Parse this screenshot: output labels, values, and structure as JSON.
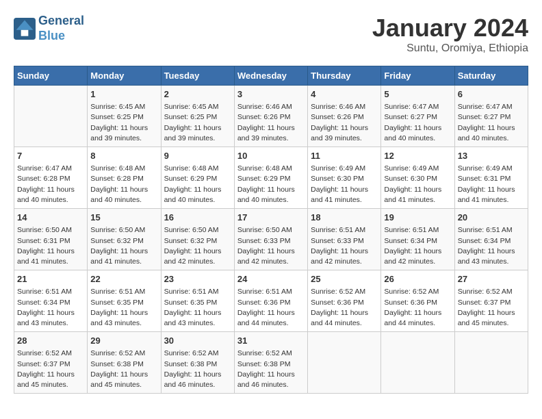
{
  "header": {
    "logo_line1": "General",
    "logo_line2": "Blue",
    "main_title": "January 2024",
    "subtitle": "Suntu, Oromiya, Ethiopia"
  },
  "weekdays": [
    "Sunday",
    "Monday",
    "Tuesday",
    "Wednesday",
    "Thursday",
    "Friday",
    "Saturday"
  ],
  "weeks": [
    [
      {
        "day": "",
        "content": ""
      },
      {
        "day": "1",
        "content": "Sunrise: 6:45 AM\nSunset: 6:25 PM\nDaylight: 11 hours and 39 minutes."
      },
      {
        "day": "2",
        "content": "Sunrise: 6:45 AM\nSunset: 6:25 PM\nDaylight: 11 hours and 39 minutes."
      },
      {
        "day": "3",
        "content": "Sunrise: 6:46 AM\nSunset: 6:26 PM\nDaylight: 11 hours and 39 minutes."
      },
      {
        "day": "4",
        "content": "Sunrise: 6:46 AM\nSunset: 6:26 PM\nDaylight: 11 hours and 39 minutes."
      },
      {
        "day": "5",
        "content": "Sunrise: 6:47 AM\nSunset: 6:27 PM\nDaylight: 11 hours and 40 minutes."
      },
      {
        "day": "6",
        "content": "Sunrise: 6:47 AM\nSunset: 6:27 PM\nDaylight: 11 hours and 40 minutes."
      }
    ],
    [
      {
        "day": "7",
        "content": "Sunrise: 6:47 AM\nSunset: 6:28 PM\nDaylight: 11 hours and 40 minutes."
      },
      {
        "day": "8",
        "content": "Sunrise: 6:48 AM\nSunset: 6:28 PM\nDaylight: 11 hours and 40 minutes."
      },
      {
        "day": "9",
        "content": "Sunrise: 6:48 AM\nSunset: 6:29 PM\nDaylight: 11 hours and 40 minutes."
      },
      {
        "day": "10",
        "content": "Sunrise: 6:48 AM\nSunset: 6:29 PM\nDaylight: 11 hours and 40 minutes."
      },
      {
        "day": "11",
        "content": "Sunrise: 6:49 AM\nSunset: 6:30 PM\nDaylight: 11 hours and 41 minutes."
      },
      {
        "day": "12",
        "content": "Sunrise: 6:49 AM\nSunset: 6:30 PM\nDaylight: 11 hours and 41 minutes."
      },
      {
        "day": "13",
        "content": "Sunrise: 6:49 AM\nSunset: 6:31 PM\nDaylight: 11 hours and 41 minutes."
      }
    ],
    [
      {
        "day": "14",
        "content": "Sunrise: 6:50 AM\nSunset: 6:31 PM\nDaylight: 11 hours and 41 minutes."
      },
      {
        "day": "15",
        "content": "Sunrise: 6:50 AM\nSunset: 6:32 PM\nDaylight: 11 hours and 41 minutes."
      },
      {
        "day": "16",
        "content": "Sunrise: 6:50 AM\nSunset: 6:32 PM\nDaylight: 11 hours and 42 minutes."
      },
      {
        "day": "17",
        "content": "Sunrise: 6:50 AM\nSunset: 6:33 PM\nDaylight: 11 hours and 42 minutes."
      },
      {
        "day": "18",
        "content": "Sunrise: 6:51 AM\nSunset: 6:33 PM\nDaylight: 11 hours and 42 minutes."
      },
      {
        "day": "19",
        "content": "Sunrise: 6:51 AM\nSunset: 6:34 PM\nDaylight: 11 hours and 42 minutes."
      },
      {
        "day": "20",
        "content": "Sunrise: 6:51 AM\nSunset: 6:34 PM\nDaylight: 11 hours and 43 minutes."
      }
    ],
    [
      {
        "day": "21",
        "content": "Sunrise: 6:51 AM\nSunset: 6:34 PM\nDaylight: 11 hours and 43 minutes."
      },
      {
        "day": "22",
        "content": "Sunrise: 6:51 AM\nSunset: 6:35 PM\nDaylight: 11 hours and 43 minutes."
      },
      {
        "day": "23",
        "content": "Sunrise: 6:51 AM\nSunset: 6:35 PM\nDaylight: 11 hours and 43 minutes."
      },
      {
        "day": "24",
        "content": "Sunrise: 6:51 AM\nSunset: 6:36 PM\nDaylight: 11 hours and 44 minutes."
      },
      {
        "day": "25",
        "content": "Sunrise: 6:52 AM\nSunset: 6:36 PM\nDaylight: 11 hours and 44 minutes."
      },
      {
        "day": "26",
        "content": "Sunrise: 6:52 AM\nSunset: 6:36 PM\nDaylight: 11 hours and 44 minutes."
      },
      {
        "day": "27",
        "content": "Sunrise: 6:52 AM\nSunset: 6:37 PM\nDaylight: 11 hours and 45 minutes."
      }
    ],
    [
      {
        "day": "28",
        "content": "Sunrise: 6:52 AM\nSunset: 6:37 PM\nDaylight: 11 hours and 45 minutes."
      },
      {
        "day": "29",
        "content": "Sunrise: 6:52 AM\nSunset: 6:38 PM\nDaylight: 11 hours and 45 minutes."
      },
      {
        "day": "30",
        "content": "Sunrise: 6:52 AM\nSunset: 6:38 PM\nDaylight: 11 hours and 46 minutes."
      },
      {
        "day": "31",
        "content": "Sunrise: 6:52 AM\nSunset: 6:38 PM\nDaylight: 11 hours and 46 minutes."
      },
      {
        "day": "",
        "content": ""
      },
      {
        "day": "",
        "content": ""
      },
      {
        "day": "",
        "content": ""
      }
    ]
  ]
}
